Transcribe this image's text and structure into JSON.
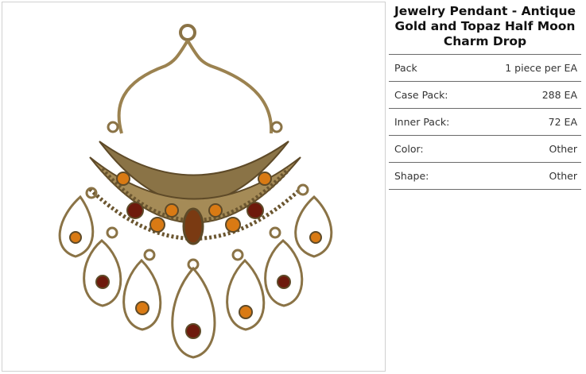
{
  "product": {
    "title": "Jewelry Pendant - Antique Gold and Topaz Half Moon Charm Drop",
    "image_alt": "Antique gold half moon charm drop pendant with topaz crystals"
  },
  "specs": [
    {
      "label": "Pack",
      "value": "1 piece per EA"
    },
    {
      "label": "Case Pack:",
      "value": "288 EA"
    },
    {
      "label": "Inner Pack:",
      "value": "72 EA"
    },
    {
      "label": "Color:",
      "value": "Other"
    },
    {
      "label": "Shape:",
      "value": "Other"
    }
  ],
  "colors": {
    "gold": "#9b8250",
    "gold_dark": "#5e4a28",
    "topaz": "#d97a14",
    "garnet": "#6e1a0c"
  }
}
